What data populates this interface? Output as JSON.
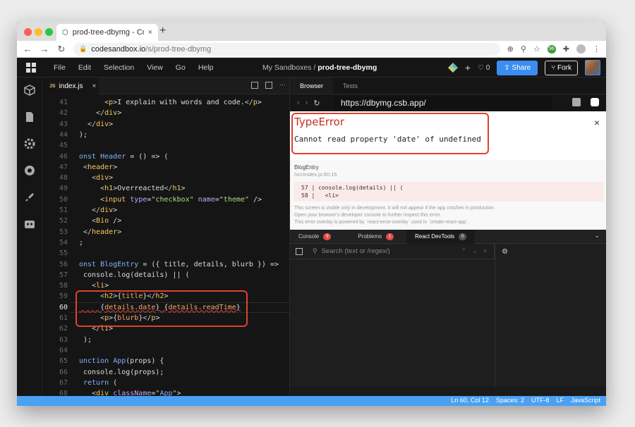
{
  "browser": {
    "tab_title": "prod-tree-dbymg - CodeSandbox",
    "tab_close": "×",
    "new_tab": "+",
    "address_domain": "codesandbox.io",
    "address_path": "/s/prod-tree-dbymg",
    "ext_badge": "96"
  },
  "app": {
    "menu": [
      "File",
      "Edit",
      "Selection",
      "View",
      "Go",
      "Help"
    ],
    "breadcrumb_parent": "My Sandboxes",
    "breadcrumb_sep": "/",
    "breadcrumb_current": "prod-tree-dbymg",
    "plus": "+",
    "likes": "♡ 0",
    "share_label": "Share",
    "fork_label": "Fork"
  },
  "editor": {
    "tab_badge": "JS",
    "tab_name": "index.js",
    "tab_close": "×"
  },
  "code_lines": [
    {
      "n": "41",
      "t": "      <p>I explain with words and code.</p>"
    },
    {
      "n": "42",
      "t": "    </div>"
    },
    {
      "n": "43",
      "t": "  </div>"
    },
    {
      "n": "44",
      "t": ");"
    },
    {
      "n": "45",
      "t": ""
    },
    {
      "n": "46",
      "t": "onst Header = () => ("
    },
    {
      "n": "47",
      "t": " <header>"
    },
    {
      "n": "48",
      "t": "   <div>"
    },
    {
      "n": "49",
      "t": "     <h1>Overreacted</h1>"
    },
    {
      "n": "50",
      "t": "     <input type=\"checkbox\" name=\"theme\" />"
    },
    {
      "n": "51",
      "t": "   </div>"
    },
    {
      "n": "52",
      "t": "   <Bio />"
    },
    {
      "n": "53",
      "t": " </header>"
    },
    {
      "n": "54",
      "t": ";"
    },
    {
      "n": "55",
      "t": ""
    },
    {
      "n": "56",
      "t": "onst BlogEntry = ({ title, details, blurb }) =>"
    },
    {
      "n": "57",
      "t": " console.log(details) || ("
    },
    {
      "n": "58",
      "t": "   <li>"
    },
    {
      "n": "59",
      "t": "     <h2>{title}</h2>"
    },
    {
      "n": "60",
      "t": "     {details.date} {details.readTime}"
    },
    {
      "n": "61",
      "t": "     <p>{blurb}</p>"
    },
    {
      "n": "62",
      "t": "   </li>"
    },
    {
      "n": "63",
      "t": " );"
    },
    {
      "n": "64",
      "t": ""
    },
    {
      "n": "65",
      "t": "unction App(props) {"
    },
    {
      "n": "66",
      "t": " console.log(props);"
    },
    {
      "n": "67",
      "t": " return ("
    },
    {
      "n": "68",
      "t": "   <div className=\"App\">"
    }
  ],
  "preview": {
    "tab_browser": "Browser",
    "tab_tests": "Tests",
    "url": "https://dbymg.csb.app/",
    "error_title": "TypeError",
    "error_message": "Cannot read property 'date' of undefined",
    "close": "×",
    "frame_name": "BlogEntry",
    "frame_loc": "/src/index.js:60:15",
    "snippet_1": "57 | console.log(details) || (",
    "snippet_2": "58 |   <li>",
    "note_1": "This screen is visible only in development. It will not appear if the app crashes in production.",
    "note_2": "Open your browser's developer console to further inspect this error.",
    "note_3": "This error overlay is powered by `react-error-overlay` used in `create-react-app`."
  },
  "devtools": {
    "tab_console": "Console",
    "console_count": "9",
    "tab_problems": "Problems",
    "problems_count": "1",
    "tab_react": "React DevTools",
    "react_count": "0",
    "search_placeholder": "Search (text or /regex/)"
  },
  "status": {
    "position": "Ln 60, Col 12",
    "spaces": "Spaces: 2",
    "encoding": "UTF-8",
    "eol": "LF",
    "language": "JavaScript"
  },
  "colors": {
    "accent": "#4aa0f2",
    "error": "#cc2b1d",
    "highlight_box": "#e0412c"
  }
}
